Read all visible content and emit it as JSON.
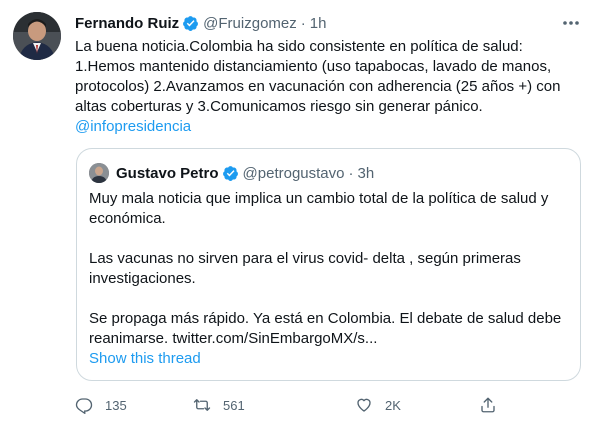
{
  "tweet": {
    "author": {
      "name": "Fernando Ruiz",
      "handle": "@Fruizgomez",
      "separator": "·",
      "time": "1h",
      "verified": true
    },
    "text_line1": "La buena noticia.Colombia ha sido consistente en política de salud:",
    "text_line2": "1.Hemos mantenido distanciamiento (uso tapabocas, lavado de manos,",
    "text_line3": "protocolos) 2.Avanzamos en vacunación con adherencia (25 años +) con",
    "text_line4": "altas coberturas y 3.Comunicamos riesgo sin generar pánico.",
    "mention": "@infopresidencia"
  },
  "quote": {
    "author": {
      "name": "Gustavo Petro",
      "handle": "@petrogustavo",
      "separator": "·",
      "time": "3h",
      "verified": true
    },
    "para1": "Muy mala noticia que implica un cambio total de la política de salud y económica.",
    "para2": "Las vacunas no sirven para el virus covid- delta , según primeras investigaciones.",
    "para3": "Se propaga más rápido. Ya está en Colombia. El debate de salud debe reanimarse. twitter.com/SinEmbargoMX/s...",
    "show_thread": "Show this thread"
  },
  "actions": {
    "reply": {
      "icon": "reply-icon",
      "count": "135"
    },
    "retweet": {
      "icon": "retweet-icon",
      "count": "561"
    },
    "like": {
      "icon": "heart-icon",
      "count": "2K"
    },
    "share": {
      "icon": "share-icon",
      "count": ""
    }
  },
  "colors": {
    "accent": "#1d9bf0",
    "text": "#0f1419",
    "muted": "#536471",
    "border": "#cfd9de"
  }
}
